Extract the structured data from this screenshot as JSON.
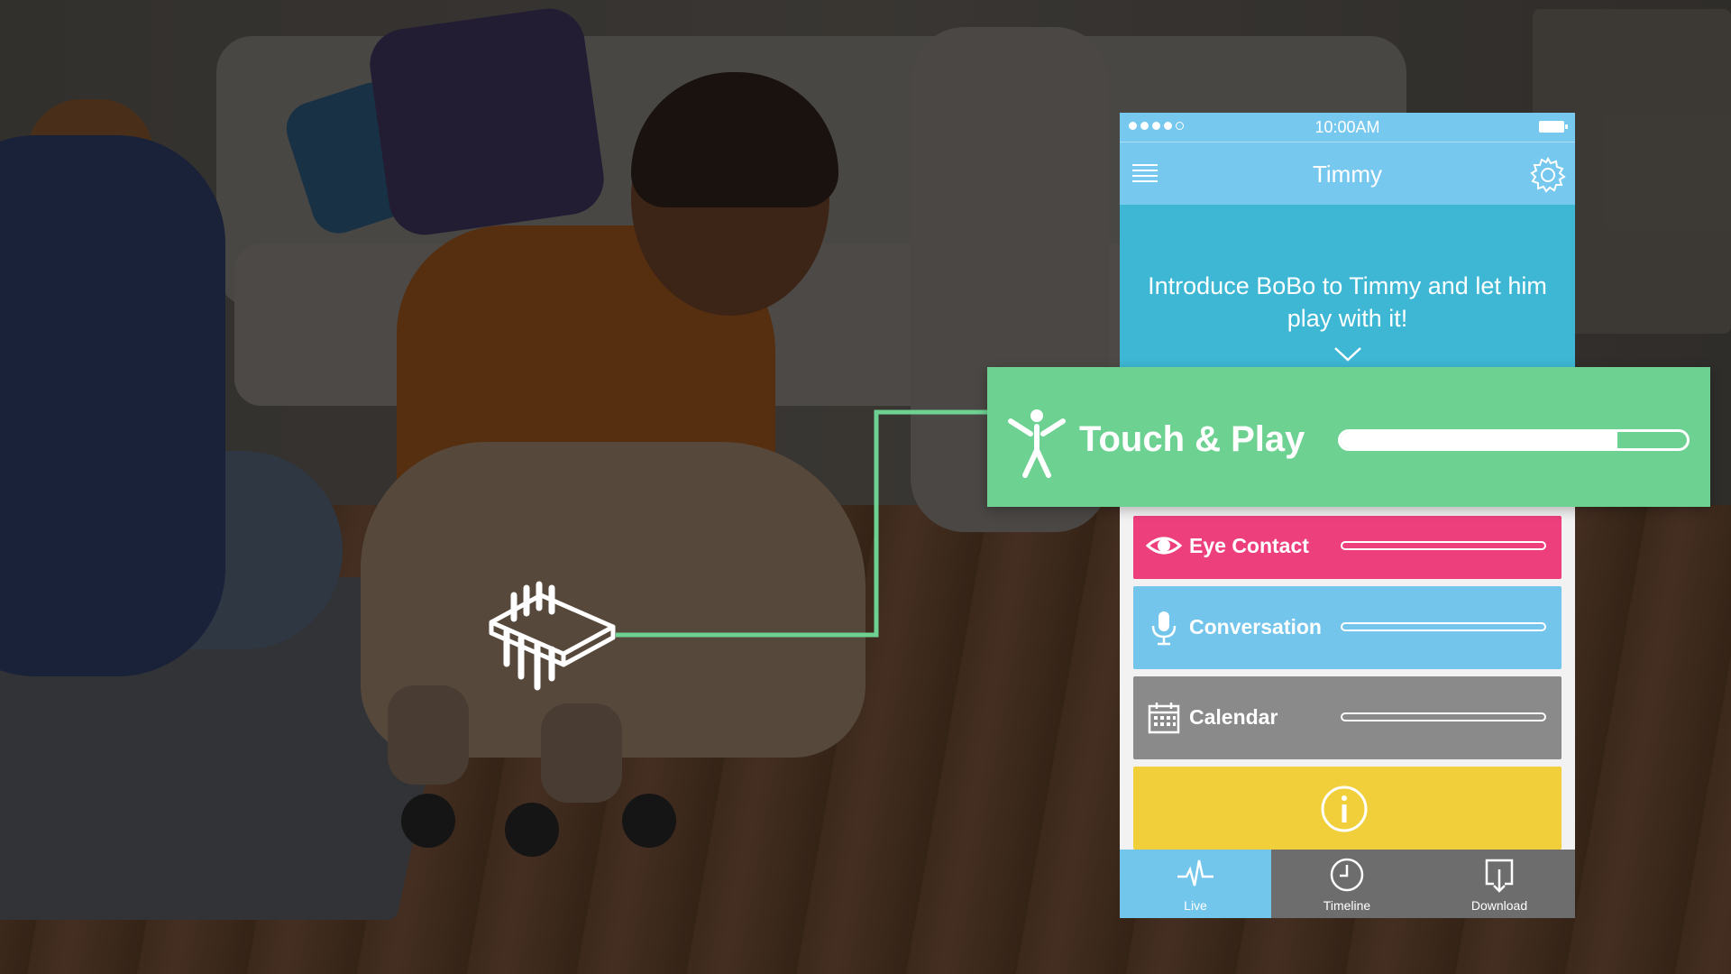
{
  "status_bar": {
    "time": "10:00AM",
    "signal_filled": 4,
    "signal_total": 5
  },
  "nav": {
    "title": "Timmy",
    "menu_icon": "hamburger-icon",
    "settings_icon": "gear-icon"
  },
  "banner": {
    "message": "Introduce BoBo to Timmy and let him play with it!",
    "chevron_icon": "chevron-down-icon"
  },
  "activities": [
    {
      "label": "Touch & Play",
      "icon": "person-icon",
      "progress": 0.8,
      "color": "#6dd192"
    },
    {
      "label": "Eye Contact",
      "icon": "eye-icon",
      "progress": 0,
      "color": "#ee3f7d"
    },
    {
      "label": "Conversation",
      "icon": "microphone-icon",
      "progress": 0,
      "color": "#74c5ec"
    },
    {
      "label": "Calendar",
      "icon": "calendar-icon",
      "progress": 0,
      "color": "#8a8a8a"
    }
  ],
  "info": {
    "icon": "info-icon",
    "color": "#f0cf3a"
  },
  "tabs": [
    {
      "label": "Live",
      "icon": "heartbeat-icon",
      "active": true
    },
    {
      "label": "Timeline",
      "icon": "clock-icon",
      "active": false
    },
    {
      "label": "Download",
      "icon": "download-icon",
      "active": false
    }
  ],
  "sensor": {
    "icon": "sensor-chip-icon"
  },
  "colors": {
    "header_blue": "#77c8ee",
    "banner_blue": "#3db7d4",
    "connector_green": "#6dd192"
  }
}
